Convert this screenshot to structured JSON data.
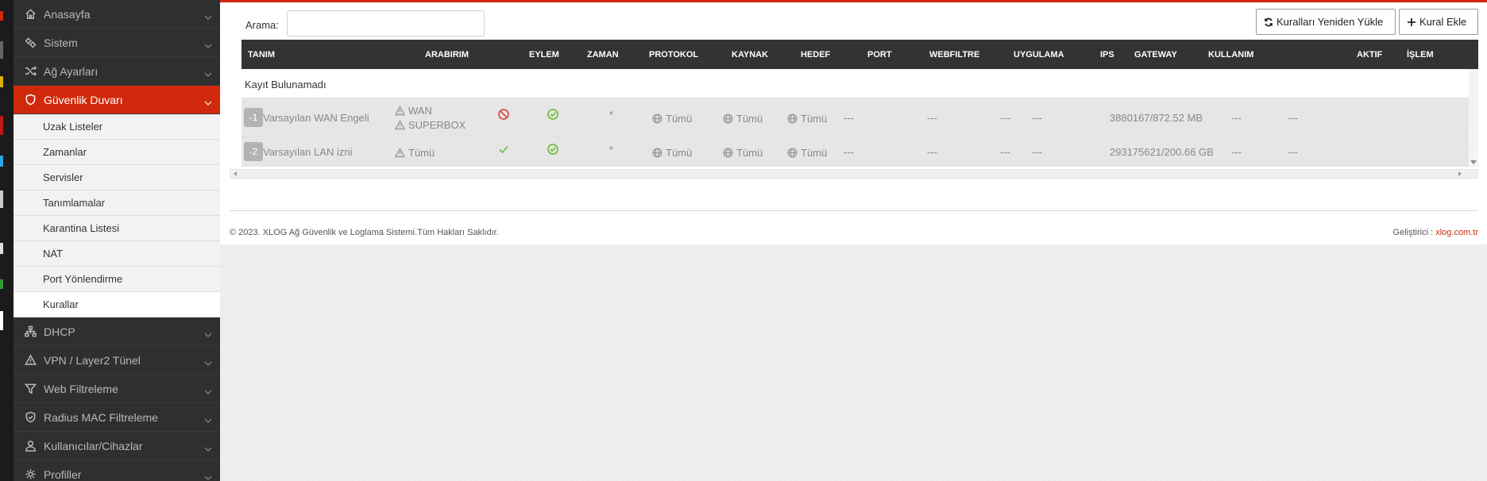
{
  "colors": {
    "accent": "#d0290c",
    "sidebar_bg": "#2f2f2f",
    "table_header_bg": "#333333",
    "deny": "#d94a4a",
    "ok": "#6fbf3a"
  },
  "sidebar": {
    "items": [
      {
        "label": "Anasayfa",
        "icon": "home-icon"
      },
      {
        "label": "Sistem",
        "icon": "gears-icon"
      },
      {
        "label": "Ağ Ayarları",
        "icon": "shuffle-icon"
      },
      {
        "label": "Güvenlik Duvarı",
        "icon": "shield-icon",
        "active": true,
        "children": [
          "Uzak Listeler",
          "Zamanlar",
          "Servisler",
          "Tanımlamalar",
          "Karantina Listesi",
          "NAT",
          "Port Yönlendirme",
          "Kurallar"
        ],
        "active_child": "Kurallar"
      },
      {
        "label": "DHCP",
        "icon": "network-icon"
      },
      {
        "label": "VPN / Layer2 Tünel",
        "icon": "warning-icon"
      },
      {
        "label": "Web Filtreleme",
        "icon": "filter-icon"
      },
      {
        "label": "Radius MAC Filtreleme",
        "icon": "shield-check-icon"
      },
      {
        "label": "Kullanıcılar/Cihazlar",
        "icon": "user-icon"
      },
      {
        "label": "Profiller",
        "icon": "gear-icon"
      }
    ]
  },
  "search": {
    "label": "Arama:",
    "value": "",
    "placeholder": ""
  },
  "toolbar": {
    "reload_label": "Kuralları Yeniden Yükle",
    "add_label": "Kural Ekle"
  },
  "table": {
    "columns": [
      "TANIM",
      "ARABIRIM",
      "EYLEM",
      "ZAMAN",
      "PROTOKOL",
      "KAYNAK",
      "HEDEF",
      "PORT",
      "WEBFILTRE",
      "UYGULAMA",
      "IPS",
      "GATEWAY",
      "KULLANIM",
      "AKTIF",
      "İŞLEM"
    ],
    "empty_text": "Kayıt Bulunamadı",
    "rows": [
      {
        "id": "-1",
        "name": "Varsayılan WAN Engeli",
        "interfaces": [
          "WAN",
          "SUPERBOX"
        ],
        "action": "deny",
        "time": "ok",
        "protocol": "*",
        "source": "Tümü",
        "destination": "Tümü",
        "port": "Tümü",
        "webfilter": "---",
        "application": "---",
        "ips": "---",
        "gateway": "---",
        "usage": "3880167/872.52 MB",
        "active": "---",
        "operation": "---"
      },
      {
        "id": "-2",
        "name": "Varsayılan LAN izni",
        "interfaces": [
          "Tümü"
        ],
        "action": "allow",
        "time": "ok",
        "protocol": "*",
        "source": "Tümü",
        "destination": "Tümü",
        "port": "Tümü",
        "webfilter": "---",
        "application": "---",
        "ips": "---",
        "gateway": "---",
        "usage": "293175621/200.66 GB",
        "active": "---",
        "operation": "---"
      }
    ]
  },
  "footer": {
    "copyright": "© 2023. XLOG Ağ Güvenlik ve Loglama Sistemi.Tüm Hakları Saklıdır.",
    "dev_label": "Geliştirici :",
    "dev_link": "xlog.com.tr"
  }
}
